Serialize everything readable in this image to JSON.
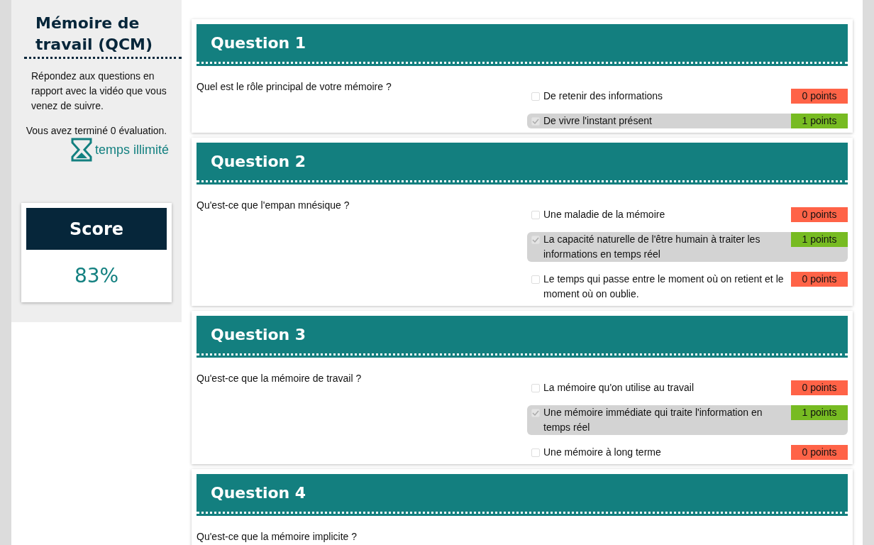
{
  "sidebar": {
    "title": "Mémoire de travail (QCM)",
    "intro": "Répondez aux questions en rapport avec la vidéo que vous venez de suivre.",
    "completed": "Vous avez terminé 0 évaluation.",
    "time_limit": "temps illimité",
    "score": {
      "label": "Score",
      "value": "83%"
    }
  },
  "questions": [
    {
      "title": "Question 1",
      "text": "Quel est le rôle principal de votre mémoire ?",
      "answers": [
        {
          "text": "De retenir des informations",
          "selected": false,
          "points": "0 points",
          "color": "#ff6347"
        },
        {
          "text": "De vivre l'instant présent",
          "selected": true,
          "points": "1 points",
          "color": "#77bb22"
        }
      ]
    },
    {
      "title": "Question 2",
      "text": "Qu'est-ce que l'empan mnésique ?",
      "answers": [
        {
          "text": "Une maladie de la mémoire",
          "selected": false,
          "points": "0 points",
          "color": "#ff6347"
        },
        {
          "text": "La capacité naturelle de l'être humain à traiter les informations en temps réel",
          "selected": true,
          "points": "1 points",
          "color": "#77bb22"
        },
        {
          "text": "Le temps qui passe entre le moment où on retient et le moment où on oublie.",
          "selected": false,
          "points": "0 points",
          "color": "#ff6347"
        }
      ]
    },
    {
      "title": "Question 3",
      "text": "Qu'est-ce que la mémoire de travail ?",
      "answers": [
        {
          "text": "La mémoire qu'on utilise au travail",
          "selected": false,
          "points": "0 points",
          "color": "#ff6347"
        },
        {
          "text": "Une mémoire immédiate qui traite l'information en temps réel",
          "selected": true,
          "points": "1 points",
          "color": "#77bb22"
        },
        {
          "text": "Une mémoire à long terme",
          "selected": false,
          "points": "0 points",
          "color": "#ff6347"
        }
      ]
    },
    {
      "title": "Question 4",
      "text": "Qu'est-ce que la mémoire implicite ?"
    }
  ]
}
